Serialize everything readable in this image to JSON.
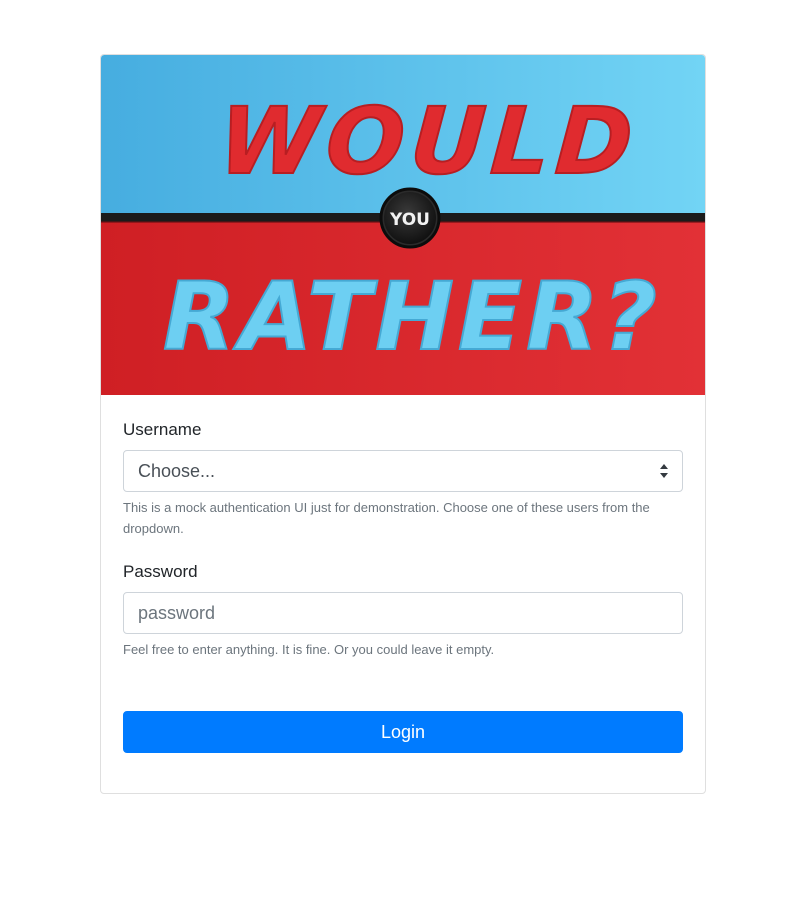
{
  "banner": {
    "word_top": "WOULD",
    "word_middle": "YOU",
    "word_bottom": "RATHER?",
    "colors": {
      "top_band": "#5ec4ec",
      "bottom_band": "#d92228",
      "top_text": "#e02b2f",
      "bottom_text": "#6dcff2",
      "divider": "#1b1b1b"
    }
  },
  "form": {
    "username": {
      "label": "Username",
      "selected": "Choose...",
      "help": "This is a mock authentication UI just for demonstration. Choose one of these users from the dropdown."
    },
    "password": {
      "label": "Password",
      "placeholder": "password",
      "value": "",
      "help": "Feel free to enter anything. It is fine. Or you could leave it empty."
    },
    "submit_label": "Login"
  },
  "theme": {
    "primary": "#007bff",
    "border": "#ced4da",
    "muted": "#6c757d"
  }
}
